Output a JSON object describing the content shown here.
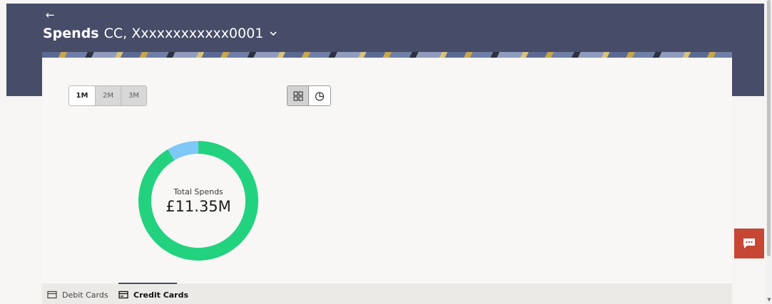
{
  "header": {
    "back_icon": "arrow-left-icon",
    "title_bold": "Spends",
    "title_rest": "CC, Xxxxxxxxxxxx0001",
    "dropdown_icon": "chevron-down-icon",
    "background_color": "#474c68"
  },
  "period_filter": {
    "options": [
      {
        "label": "1M",
        "active": true
      },
      {
        "label": "2M",
        "active": false
      },
      {
        "label": "3M",
        "active": false
      }
    ]
  },
  "view_toggle": {
    "grid_icon": "grid-view-icon",
    "pie_icon": "pie-chart-icon",
    "active": "pie"
  },
  "chart_data": {
    "type": "pie",
    "style": "donut",
    "center_label": "Total Spends",
    "center_value": "£11.35M",
    "slices": [
      {
        "share": 0.915,
        "color": "#22d27f"
      },
      {
        "share": 0.085,
        "color": "#7ec8f8"
      }
    ]
  },
  "tabs": [
    {
      "label": "Debit Cards",
      "icon": "debit-card-icon",
      "active": false
    },
    {
      "label": "Credit Cards",
      "icon": "credit-card-icon",
      "active": true
    }
  ],
  "chat": {
    "icon": "chat-bubble-icon",
    "color": "#c74634"
  }
}
